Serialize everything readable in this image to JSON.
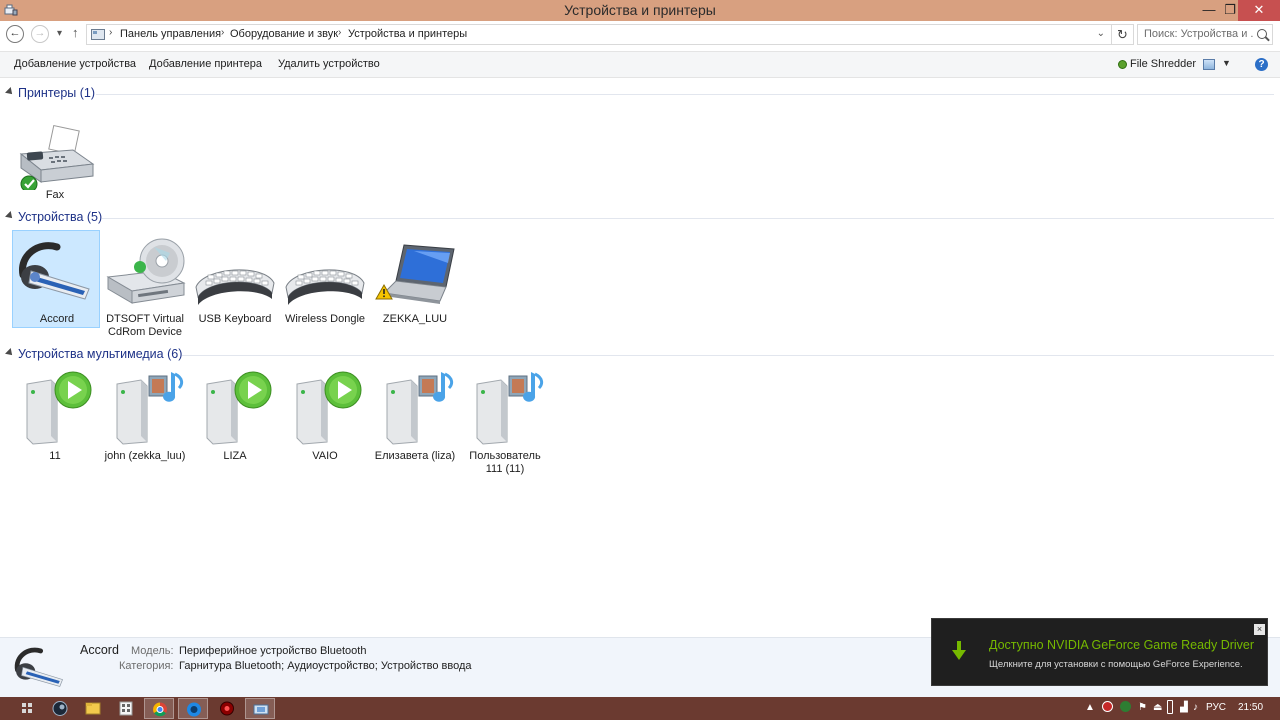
{
  "window": {
    "title": "Устройства и принтеры",
    "min": "—",
    "max": "❐",
    "close": "✕"
  },
  "address": {
    "crumbs": [
      "Панель управления",
      "Оборудование и звук",
      "Устройства и принтеры"
    ],
    "separator": "›",
    "search_placeholder": "Поиск: Устройства и ..."
  },
  "commands": {
    "add_device": "Добавление устройства",
    "add_printer": "Добавление принтера",
    "remove_device": "Удалить устройство",
    "file_shredder": "File Shredder"
  },
  "groups": {
    "printers": {
      "title": "Принтеры (1)",
      "items": [
        {
          "label": "Fax"
        }
      ]
    },
    "devices": {
      "title": "Устройства (5)",
      "items": [
        {
          "label": "Accord"
        },
        {
          "label": "DTSOFT Virtual CdRom Device"
        },
        {
          "label": "USB Keyboard"
        },
        {
          "label": "Wireless Dongle"
        },
        {
          "label": "ZEKKA_LUU"
        }
      ]
    },
    "multimedia": {
      "title": "Устройства мультимедиа (6)",
      "items": [
        {
          "label": "11"
        },
        {
          "label": "john (zekka_luu)"
        },
        {
          "label": "LIZA"
        },
        {
          "label": "VAIO"
        },
        {
          "label": "Елизавета (liza)"
        },
        {
          "label": "Пользователь 111 (11)"
        }
      ]
    }
  },
  "details": {
    "name": "Accord",
    "model_key": "Модель:",
    "model_value": "Периферийное устройство Bluetooth",
    "category_key": "Категория:",
    "category_value": "Гарнитура Bluetooth; Аудиоустройство; Устройство ввода"
  },
  "notification": {
    "title": "Доступно NVIDIA GeForce Game Ready Driver",
    "body": "Щелкните для установки с помощью GeForce Experience.",
    "close": "×"
  },
  "taskbar": {
    "lang": "РУС",
    "time": "21:50"
  },
  "colors": {
    "titlebar": "#d8a080",
    "taskbar": "#6b3a30",
    "group_title": "#1e3287",
    "selection": "#cce8ff",
    "nvidia_green": "#76b900"
  }
}
